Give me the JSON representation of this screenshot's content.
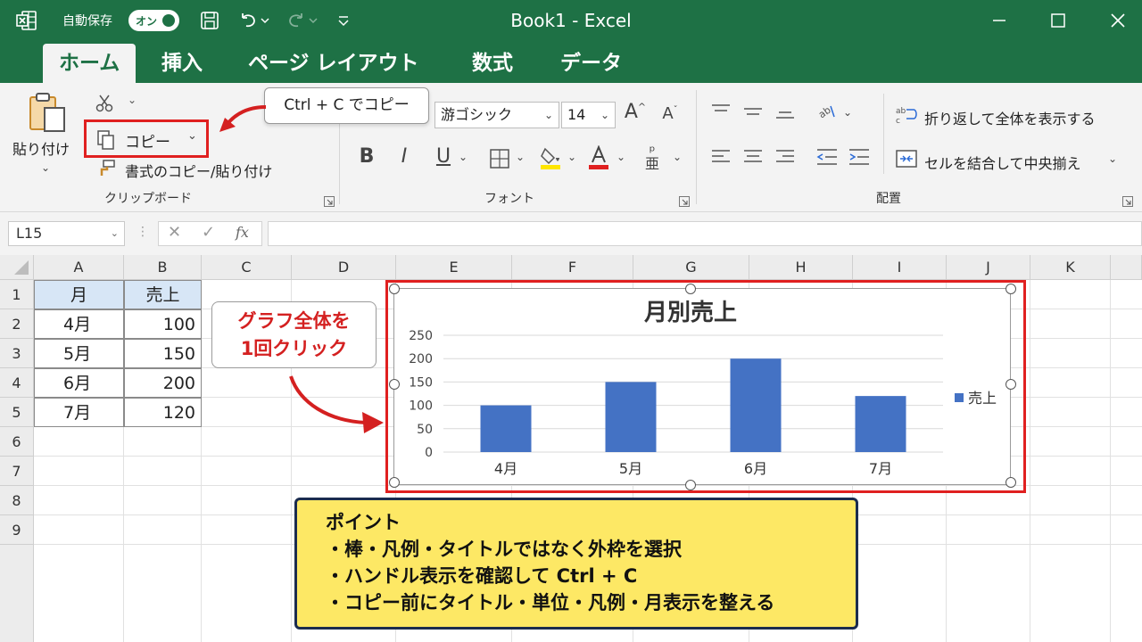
{
  "titlebar": {
    "autosave_label": "自動保存",
    "autosave_state": "オン",
    "title": "Book1  -  Excel",
    "accent": "#1e7145"
  },
  "tabs": [
    "ホーム",
    "挿入",
    "ページ レイアウト",
    "数式",
    "データ"
  ],
  "ribbon": {
    "paste_label": "貼り付け",
    "copy_label": "コピー",
    "format_painter_label": "書式のコピー/貼り付け",
    "clipboard_group": "クリップボード",
    "font_name": "游ゴシック",
    "font_size": "14",
    "font_group": "フォント",
    "wrap_text_label": "折り返して全体を表示する",
    "merge_center_label": "セルを結合して中央揃え",
    "alignment_group": "配置",
    "callout_copy": "Ctrl + C でコピー"
  },
  "formula_bar": {
    "name_box": "L15",
    "fx": "fx",
    "value": ""
  },
  "sheet": {
    "columns": [
      "A",
      "B",
      "C",
      "D",
      "E",
      "F",
      "G",
      "H",
      "I",
      "J",
      "K"
    ],
    "rows": [
      "1",
      "2",
      "3",
      "4",
      "5",
      "6",
      "7",
      "8",
      "9"
    ],
    "table_header": [
      "月",
      "売上"
    ],
    "table_rows": [
      [
        "4月",
        "100"
      ],
      [
        "5月",
        "150"
      ],
      [
        "6月",
        "200"
      ],
      [
        "7月",
        "120"
      ]
    ]
  },
  "annotations": {
    "click_note_line1": "グラフ全体を",
    "click_note_line2": "1回クリック",
    "point_title": "ポイント",
    "point_items": [
      "・棒・凡例・タイトルではなく外枠を選択",
      "・ハンドル表示を確認して Ctrl + C",
      "・コピー前にタイトル・単位・凡例・月表示を整える"
    ],
    "highlight_color": "#e02020",
    "note_bg": "#fde865"
  },
  "chart_data": {
    "type": "bar",
    "title": "月別売上",
    "categories": [
      "4月",
      "5月",
      "6月",
      "7月"
    ],
    "series": [
      {
        "name": "売上",
        "values": [
          100,
          150,
          200,
          120
        ],
        "color": "#4472c4"
      }
    ],
    "ylim": [
      0,
      250
    ],
    "yticks": [
      0,
      50,
      100,
      150,
      200,
      250
    ],
    "xlabel": "",
    "ylabel": "",
    "legend_position": "right",
    "grid": true
  }
}
